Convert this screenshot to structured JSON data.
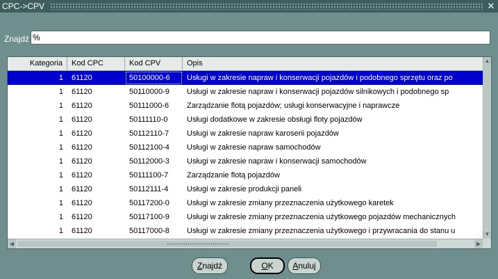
{
  "window": {
    "title": "CPC->CPV",
    "close_glyph": "✕"
  },
  "search": {
    "label": "Znajdź",
    "value": "%"
  },
  "table": {
    "columns": [
      "Kategoria",
      "Kod CPC",
      "Kod CPV",
      "Opis"
    ],
    "selected_index": 0,
    "rows": [
      [
        "1",
        "61120",
        "50100000-6",
        "Usługi w zakresie napraw i konserwacji pojazdów i podobnego sprzętu oraz po"
      ],
      [
        "1",
        "61120",
        "50110000-9",
        "Usługi w zakresie napraw i konserwacji pojazdów silnikowych i podobnego sp"
      ],
      [
        "1",
        "61120",
        "50111000-6",
        "Zarządzanie flotą pojazdów; usługi konserwacyjne i naprawcze"
      ],
      [
        "1",
        "61120",
        "50111110-0",
        "Usługi dodatkowe w zakresie obsługi floty pojazdów"
      ],
      [
        "1",
        "61120",
        "50112110-7",
        "Usługi w zakresie napraw karoserii pojazdów"
      ],
      [
        "1",
        "61120",
        "50112100-4",
        "Usługi w zakresie napraw samochodów"
      ],
      [
        "1",
        "61120",
        "50112000-3",
        "Usługi w zakresie napraw i konserwacji samochodów"
      ],
      [
        "1",
        "61120",
        "50111100-7",
        "Zarządzanie flotą pojazdów"
      ],
      [
        "1",
        "61120",
        "50112111-4",
        "Usługi w zakresie produkcji paneli"
      ],
      [
        "1",
        "61120",
        "50117200-0",
        "Usługi w zakresie zmiany przeznaczenia użytkowego karetek"
      ],
      [
        "1",
        "61120",
        "50117100-9",
        "Usługi w zakresie zmiany przeznaczenia użytkowego pojazdów mechanicznych"
      ],
      [
        "1",
        "61120",
        "50117000-8",
        "Usługi w zakresie zmiany przeznaczenia użytkowego i przywracania do stanu u"
      ]
    ]
  },
  "buttons": {
    "find": {
      "mnemonic": "Z",
      "rest": "najdź"
    },
    "ok": {
      "mnemonic": "O",
      "rest": "K"
    },
    "cancel": {
      "mnemonic": "A",
      "rest": "nuluj"
    }
  },
  "colors": {
    "window_bg": "#6f8f8f",
    "title_bg": "#3e5e5e",
    "selection": "#0000cc"
  }
}
